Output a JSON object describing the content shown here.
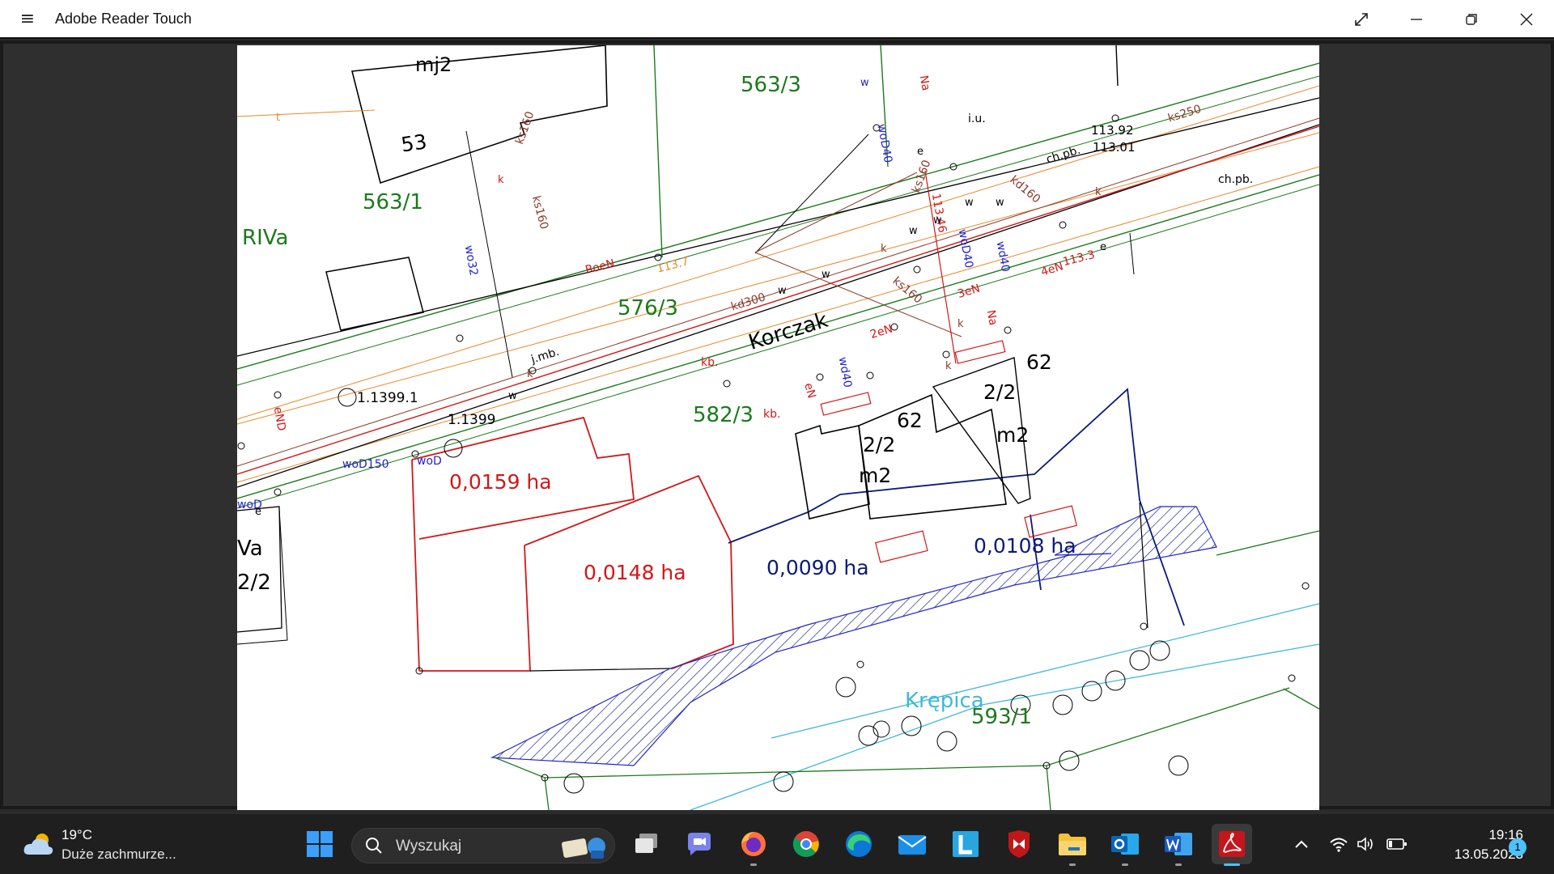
{
  "window": {
    "title": "Adobe Reader Touch",
    "menu_icon": "hamburger-menu-icon",
    "controls": [
      "fullscreen-icon",
      "minimize-icon",
      "restore-icon",
      "close-icon"
    ]
  },
  "map": {
    "parcels": [
      "mj2",
      "53",
      "563/1",
      "563/3",
      "576/3",
      "582/3",
      "593/1",
      "RIVa",
      "Va",
      "2/2"
    ],
    "street": "Korczak",
    "river": "Krępica",
    "areas": {
      "a1": "0,0159 ha",
      "a2": "0,0148 ha",
      "a3": "0,0090 ha",
      "a4": "0,0108 ha"
    },
    "buildings": {
      "left_number": "62",
      "left_fraction": "2/2",
      "left_unit": "m2",
      "right_number": "62",
      "right_fraction": "2/2",
      "right_unit": "m2"
    },
    "elevations": [
      "113.92",
      "113.01",
      "113.7",
      "113.46",
      "113.3"
    ],
    "points": [
      "1.1399.1",
      "1.1399"
    ],
    "utility_labels": {
      "ks160": "ks160",
      "ks250": "ks250",
      "kd300": "kd300",
      "kd160": "kd160",
      "wo32": "wo32",
      "wod40": "woD40",
      "wod150": "woD150",
      "wod": "woD",
      "wd40": "wd40",
      "chpb": "ch.pb.",
      "jmb": "j.mb.",
      "iu": "i.u.",
      "kb": "kb.",
      "roen": "RoeN",
      "en": "eN",
      "end": "eND",
      "en2": "2eN",
      "en3": "3eN",
      "en4": "4eN",
      "na": "Na",
      "k": "k",
      "w": "w",
      "e": "e",
      "t": "t"
    },
    "colors": {
      "red": "#d01818",
      "green": "#1b7a1b",
      "navy": "#0b1a78",
      "blue": "#2222cc",
      "cyan": "#3fb8d8",
      "brown": "#8b3a2a",
      "orange": "#e58a2a"
    }
  },
  "taskbar": {
    "weather": {
      "temp": "19°C",
      "desc": "Duże zachmurze...",
      "icon": "cloud-icon"
    },
    "search": {
      "placeholder": "Wyszukaj"
    },
    "apps": [
      "windows-start-icon",
      "task-view-icon",
      "teams-icon",
      "firefox-icon",
      "chrome-icon",
      "edge-icon",
      "mail-icon",
      "lasso-l-icon",
      "mcafee-icon",
      "file-explorer-icon",
      "outlook-icon",
      "word-icon",
      "adobe-reader-icon"
    ],
    "tray_icons": [
      "chevron-up-icon",
      "wifi-icon",
      "volume-icon",
      "battery-icon"
    ],
    "clock": {
      "time": "19:16",
      "date": "13.05.2023"
    },
    "notifications": "1"
  }
}
